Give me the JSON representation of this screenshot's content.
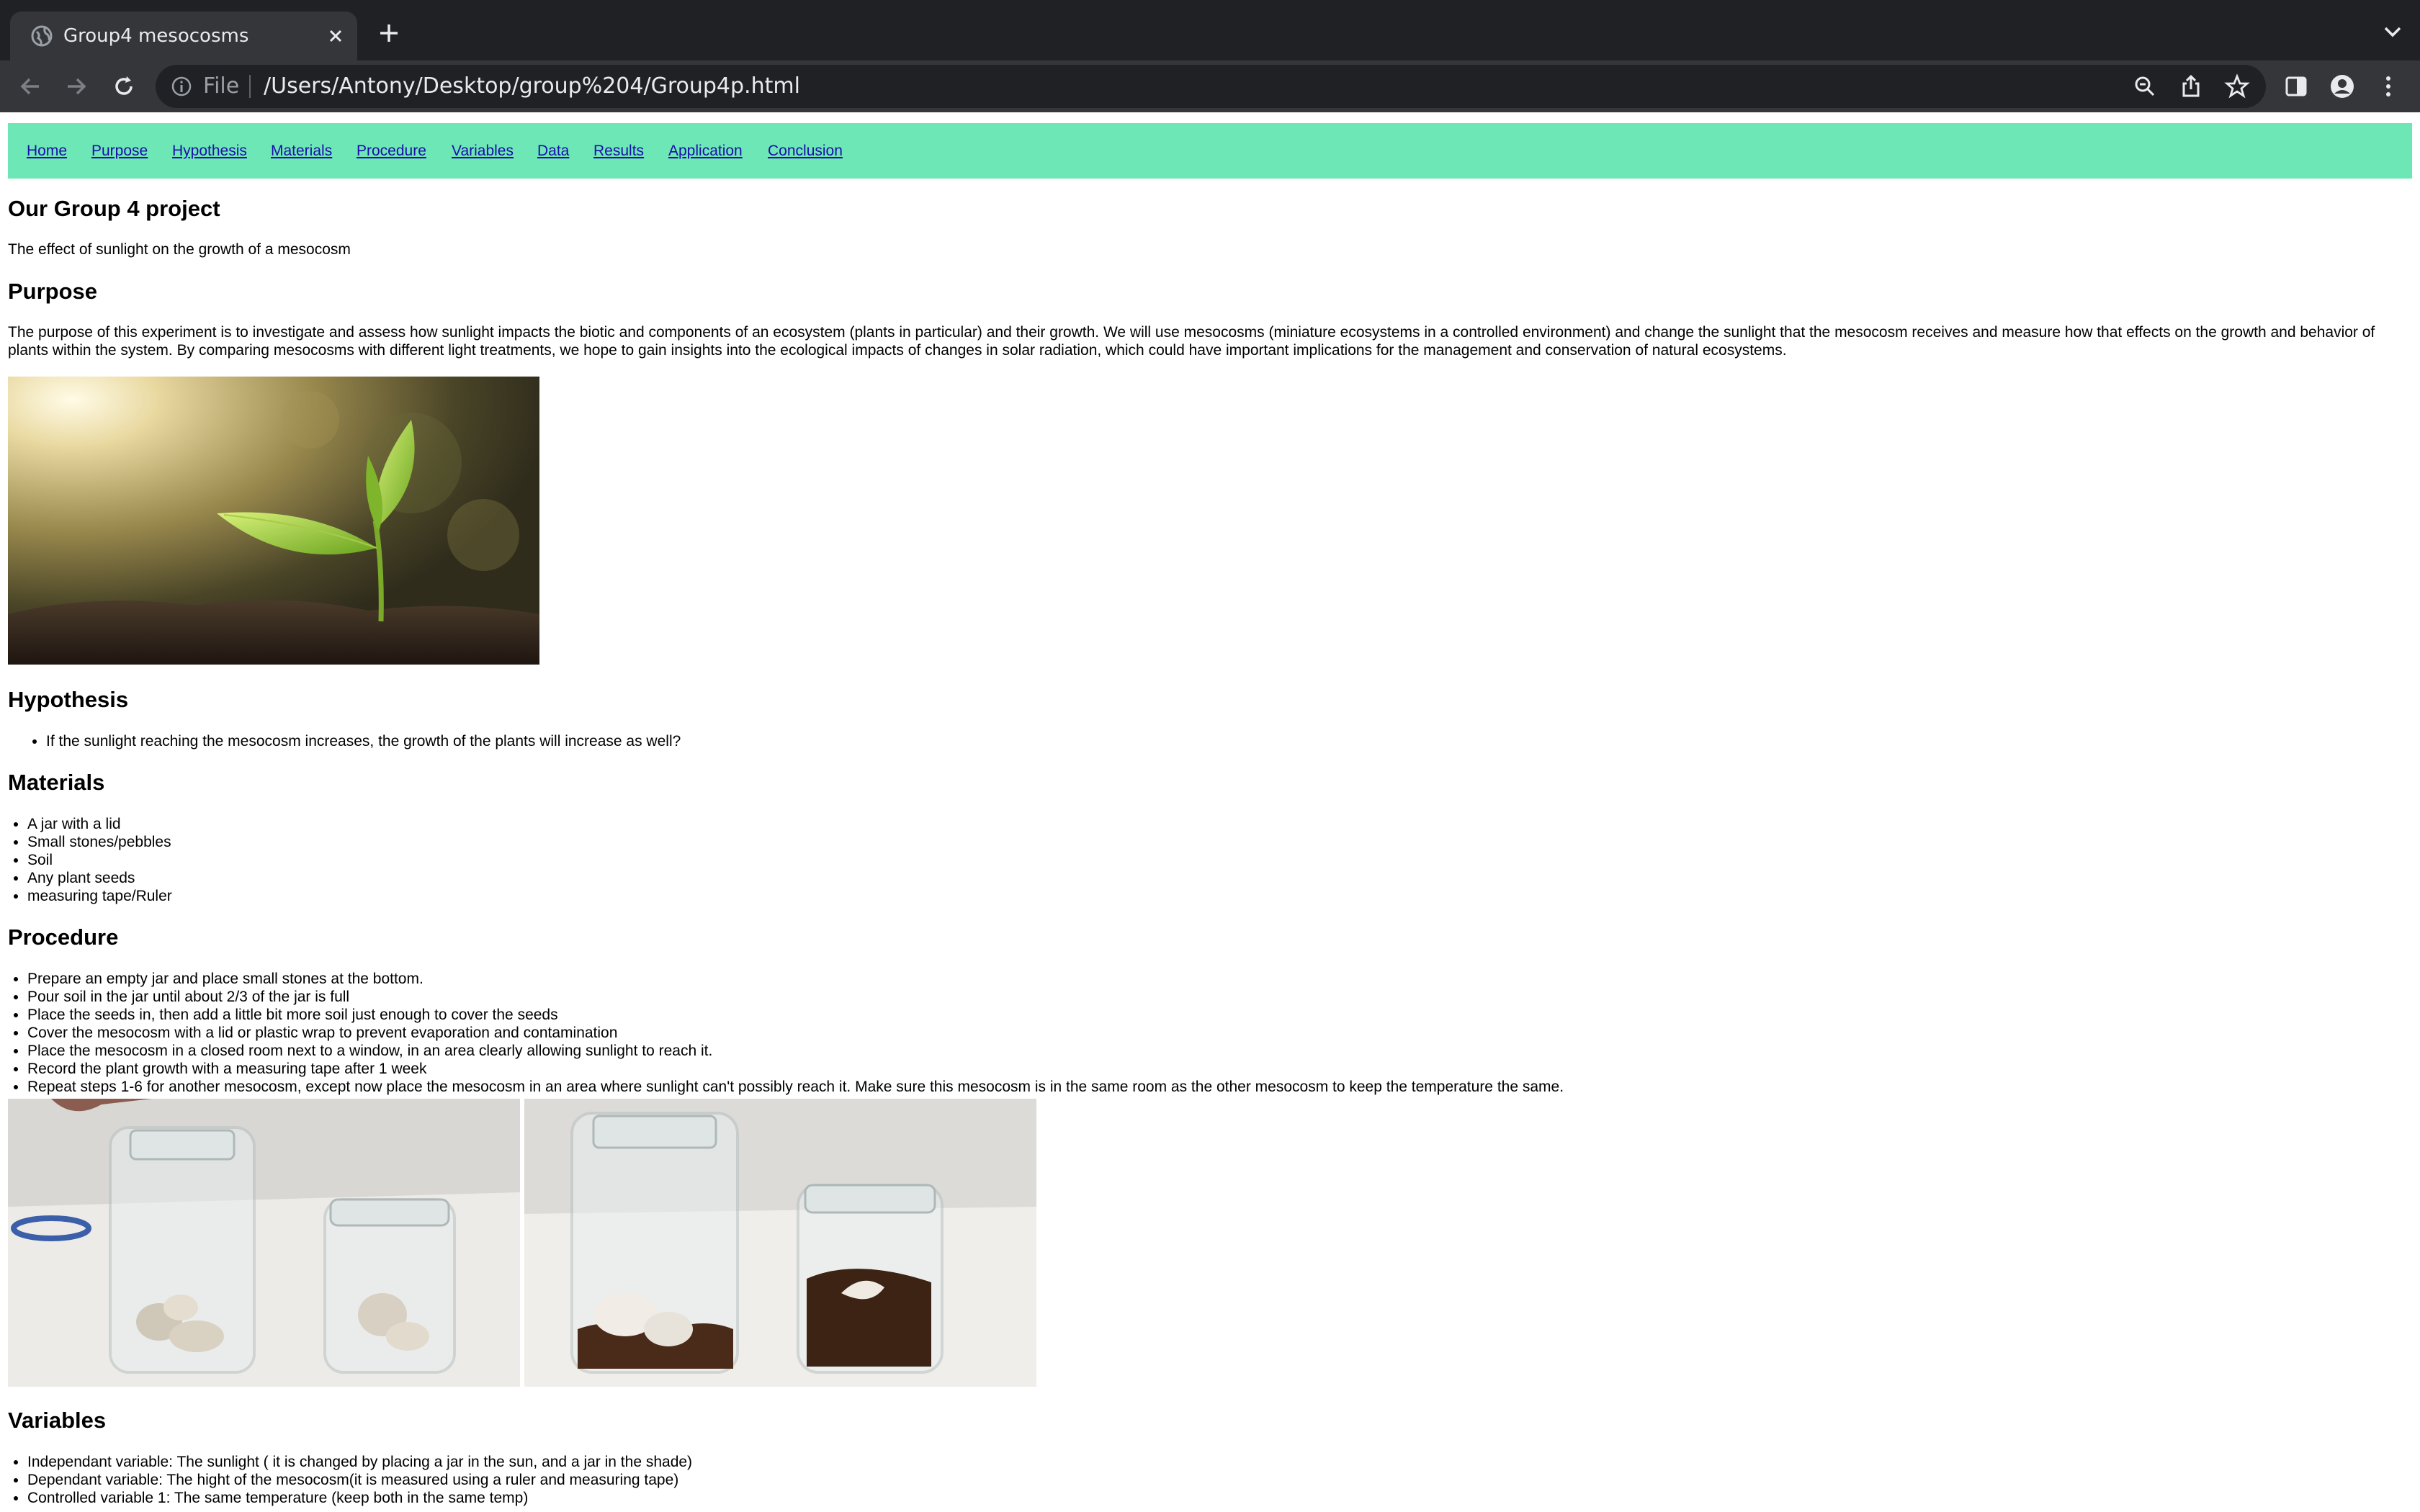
{
  "browser": {
    "tab_title": "Group4 mesocosms",
    "file_label": "File",
    "url": "/Users/Antony/Desktop/group%204/Group4p.html"
  },
  "nav": [
    "Home",
    "Purpose",
    "Hypothesis",
    "Materials",
    "Procedure",
    "Variables",
    "Data",
    "Results",
    "Application",
    "Conclusion"
  ],
  "intro": {
    "title": "Our Group 4 project",
    "subtitle": "The effect of sunlight on the growth of a mesocosm"
  },
  "purpose": {
    "title": "Purpose",
    "line1": "The purpose of this experiment is to investigate and assess how sunlight impacts the biotic and components of an ecosystem (plants in particular) and their growth. We will use mesocosms (miniature ecosystems in a controlled environment) and change the sunlight that the mesocosm receives and measure how that effects on the growth and behavior of",
    "line2": "plants within the system. By comparing mesocosms with different light treatments, we hope to gain insights into the ecological impacts of changes in solar radiation, which could have important implications for the management and conservation of natural ecosystems."
  },
  "hypothesis": {
    "title": "Hypothesis",
    "items": [
      "If the sunlight reaching the mesocosm increases, the growth of the plants will increase as well?"
    ]
  },
  "materials": {
    "title": "Materials",
    "items": [
      "A jar with a lid",
      "Small stones/pebbles",
      "Soil",
      "Any plant seeds",
      "measuring tape/Ruler"
    ]
  },
  "procedure": {
    "title": "Procedure",
    "items": [
      "Prepare an empty jar and place small stones at the bottom.",
      "Pour soil in the jar until about 2/3 of the jar is full",
      "Place the seeds in, then add a little bit more soil just enough to cover the seeds",
      "Cover the mesocosm with a lid or plastic wrap to prevent evaporation and contamination",
      "Place the mesocosm in a closed room next to a window, in an area clearly allowing sunlight to reach it.",
      "Record the plant growth with a measuring tape after 1 week",
      "Repeat steps 1-6 for another mesocosm, except now place the mesocosm in an area where sunlight can't possibly reach it. Make sure this mesocosm is in the same room as the other mesocosm to keep the temperature the same."
    ]
  },
  "variables": {
    "title": "Variables",
    "items": [
      "Independant variable: The sunlight ( it is changed by placing a jar in the sun, and a jar in the shade)",
      "Dependant variable: The hight of the mesocosm(it is measured using a ruler and measuring tape)",
      "Controlled variable 1: The same temperature (keep both in the same temp)"
    ]
  },
  "colors": {
    "nav_bg": "#6ee7b7",
    "link": "#1a0dab",
    "chrome_dark": "#202124",
    "chrome_tab": "#35363a"
  }
}
